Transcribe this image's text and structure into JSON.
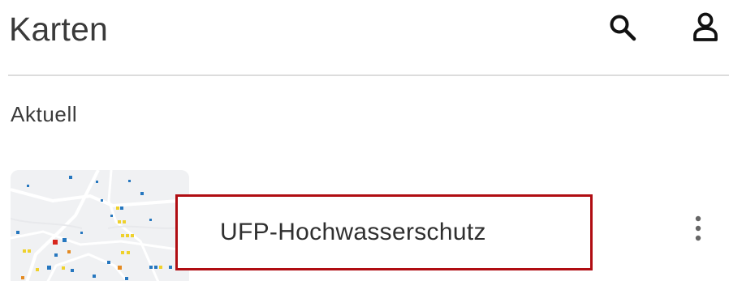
{
  "header": {
    "title": "Karten",
    "search_icon": "search-icon",
    "account_icon": "account-icon"
  },
  "section": {
    "label": "Aktuell"
  },
  "maps": [
    {
      "title": "UFP-Hochwasserschutz",
      "thumbnail_icon": "map-thumbnail",
      "menu_icon": "more-vertical-icon"
    }
  ],
  "colors": {
    "text": "#3a3a3a",
    "divider": "#dcdcdc",
    "highlight": "#b00d12",
    "map_blue": "#2677bf",
    "map_yellow": "#efd12b",
    "map_red": "#d7261d",
    "map_orange": "#e48a22"
  }
}
